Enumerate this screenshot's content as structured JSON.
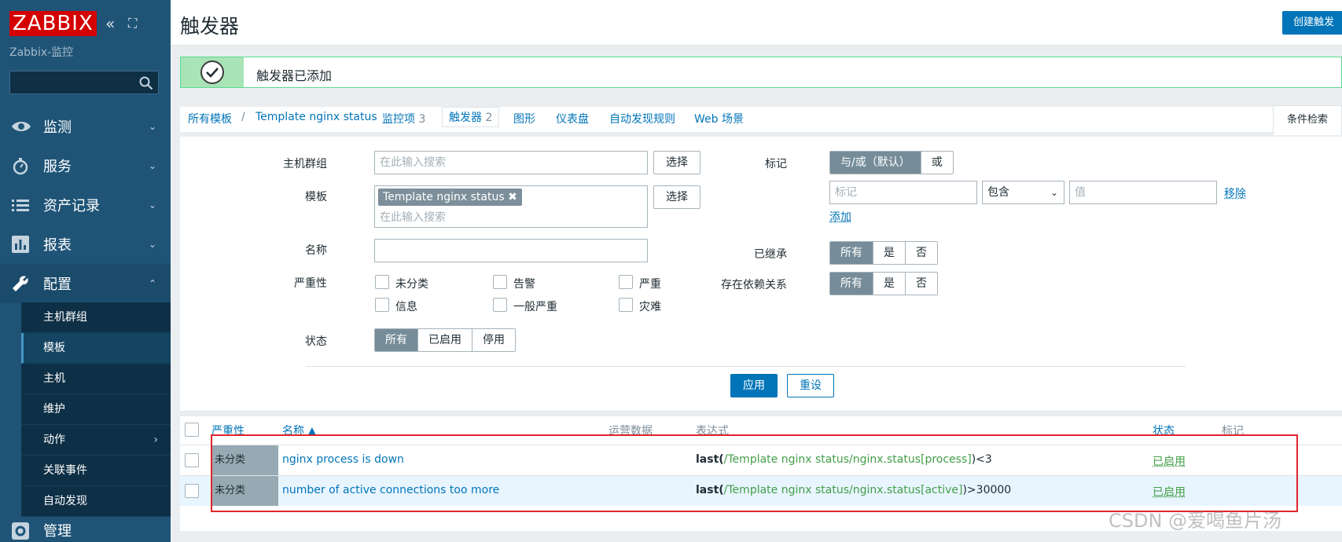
{
  "sidebar": {
    "logo": "ZABBIX",
    "subtitle": "Zabbix-监控",
    "search_placeholder": "",
    "menu": [
      {
        "label": "监测",
        "icon": "eye-icon"
      },
      {
        "label": "服务",
        "icon": "stopwatch-icon"
      },
      {
        "label": "资产记录",
        "icon": "list-icon"
      },
      {
        "label": "报表",
        "icon": "bar-chart-icon"
      },
      {
        "label": "配置",
        "icon": "wrench-icon"
      },
      {
        "label": "管理",
        "icon": "gear-icon"
      }
    ],
    "submenu": [
      "主机群组",
      "模板",
      "主机",
      "维护",
      "动作",
      "关联事件",
      "自动发现"
    ]
  },
  "header": {
    "title": "触发器",
    "create_button": "创建触发"
  },
  "message": {
    "text": "触发器已添加"
  },
  "breadcrumb": {
    "all_templates": "所有模板",
    "separator": "/",
    "template": "Template nginx status",
    "items_label": "监控项",
    "items_count": "3",
    "triggers_label": "触发器",
    "triggers_count": "2",
    "graphs": "图形",
    "dashboards": "仪表盘",
    "discovery": "自动发现规则",
    "web": "Web 场景",
    "filter_tab": "条件检索"
  },
  "filter": {
    "host_group_label": "主机群组",
    "host_group_placeholder": "在此输入搜索",
    "select_button": "选择",
    "template_label": "模板",
    "template_chip": "Template nginx status",
    "template_placeholder": "在此输入搜索",
    "name_label": "名称",
    "severity_label": "严重性",
    "severities": [
      "未分类",
      "告警",
      "严重",
      "信息",
      "一般严重",
      "灾难"
    ],
    "state_label": "状态",
    "state_options": [
      "所有",
      "已启用",
      "停用"
    ],
    "tags_label": "标记",
    "tags_mode": [
      "与/或（默认）",
      "或"
    ],
    "tag_placeholder": "标记",
    "tag_operator": "包含",
    "value_placeholder": "值",
    "remove_link": "移除",
    "add_link": "添加",
    "inherited_label": "已继承",
    "inherited_options": [
      "所有",
      "是",
      "否"
    ],
    "dependencies_label": "存在依赖关系",
    "dependencies_options": [
      "所有",
      "是",
      "否"
    ],
    "apply_button": "应用",
    "reset_button": "重设"
  },
  "table": {
    "headers": {
      "severity": "严重性",
      "name": "名称 ▲",
      "operational": "运营数据",
      "expression": "表达式",
      "status": "状态",
      "tags": "标记"
    },
    "rows": [
      {
        "severity": "未分类",
        "name": "nginx process is down",
        "expr_fn": "last(",
        "expr_item": "/Template nginx status/nginx.status[process]",
        "expr_tail": ")<3",
        "status": "已启用"
      },
      {
        "severity": "未分类",
        "name": "number of active connections too more",
        "expr_fn": "last(",
        "expr_item": "/Template nginx status/nginx.status[active]",
        "expr_tail": ")>30000",
        "status": "已启用"
      }
    ]
  },
  "watermark": "CSDN @爱喝鱼片汤"
}
